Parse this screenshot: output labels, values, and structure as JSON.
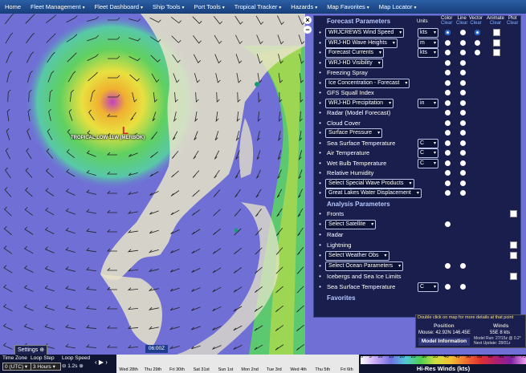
{
  "nav": [
    "Home",
    "Fleet Management",
    "Fleet Dashboard",
    "Ship Tools",
    "Port Tools",
    "Tropical Tracker",
    "Hazards",
    "Map Favorites",
    "Map Locator"
  ],
  "map": {
    "storm_label": "TROPICAL LOW 11W (MERBOK)",
    "storm_marker": "L"
  },
  "panel": {
    "title": "Forecast Parameters",
    "col_units": "Units",
    "col_color": "Color",
    "col_line": "Line",
    "col_vector": "Vector",
    "col_animate": "Animate",
    "col_plot": "Plot",
    "clear": "Clear",
    "forecast_rows": [
      {
        "label": "WRJCREWS Wind Speed",
        "select": true,
        "unit": "kts",
        "icon": "wind-icon"
      },
      {
        "label": "WRJ-HD Wave Heights",
        "select": true,
        "unit": "m",
        "icon": "wave-icon"
      },
      {
        "label": "Forecast Currents",
        "select": true,
        "unit": "kts",
        "icon": "current-icon"
      },
      {
        "label": "WRJ-HD Visibility",
        "select": true,
        "unit": "",
        "icon": "visibility-icon"
      },
      {
        "label": "Freezing Spray",
        "select": false,
        "unit": "",
        "icon": "spray-icon"
      },
      {
        "label": "Ice Concentration - Forecast",
        "select": true,
        "unit": "",
        "icon": "ice-icon"
      },
      {
        "label": "GFS Squall Index",
        "select": false,
        "unit": "",
        "icon": "squall-icon"
      },
      {
        "label": "WRJ-HD Precipitation",
        "select": true,
        "unit": "in",
        "icon": "drop-icon"
      },
      {
        "label": "Radar (Model Forecast)",
        "select": false,
        "unit": "",
        "icon": "radar-icon"
      },
      {
        "label": "Cloud Cover",
        "select": false,
        "unit": "",
        "icon": "cloud-icon"
      },
      {
        "label": "Surface Pressure",
        "select": true,
        "unit": "",
        "icon": "pressure-icon"
      },
      {
        "label": "Sea Surface Temperature",
        "select": false,
        "unit": "C",
        "icon": "thermometer-icon"
      },
      {
        "label": "Air Temperature",
        "select": false,
        "unit": "C",
        "icon": "thermometer-icon"
      },
      {
        "label": "Wet Bulb Temperature",
        "select": false,
        "unit": "C",
        "icon": "thermometer-icon"
      },
      {
        "label": "Relative Humidity",
        "select": false,
        "unit": "",
        "icon": "humidity-icon"
      },
      {
        "label": "Select Special Wave Products",
        "select": true,
        "unit": "",
        "icon": "wave-product-icon"
      },
      {
        "label": "Great Lakes Water Displacement",
        "select": true,
        "unit": "",
        "icon": "lake-icon"
      }
    ],
    "analysis_title": "Analysis Parameters",
    "analysis_rows": [
      {
        "label": "Fronts",
        "select": false,
        "icon": "fronts-icon"
      },
      {
        "label": "Select Satellite",
        "select": true,
        "icon": "satellite-icon"
      },
      {
        "label": "Radar",
        "select": false,
        "icon": "radar-icon"
      },
      {
        "label": "Lightning",
        "select": false,
        "icon": "lightning-icon"
      },
      {
        "label": "Select Weather Obs",
        "select": true,
        "icon": "obs-icon"
      },
      {
        "label": "Select Ocean Parameters",
        "select": true,
        "icon": "ocean-icon"
      },
      {
        "label": "Icebergs and Sea Ice Limits",
        "select": false,
        "icon": "iceberg-icon"
      },
      {
        "label": "Sea Surface Temperature",
        "select": false,
        "icon": "thermometer-icon",
        "unit": "C"
      }
    ],
    "favorites_title": "Favorites"
  },
  "info": {
    "note": "Double click on map for more details at that point",
    "position_hdr": "Position",
    "winds_hdr": "Winds",
    "position": "Mouse: 42.92N 146.45E",
    "winds": "55E 8 kts",
    "model_info": "Model Information",
    "model_run": "Model Run: 27/15z @ 0.2°",
    "next_update": "Next Update: 28/01z"
  },
  "bottom": {
    "settings": "Settings",
    "time_zone_lbl": "Time Zone",
    "time_zone": "0 (UTC)",
    "loop_step_lbl": "Loop Step",
    "loop_step": "3 Hours",
    "loop_speed_lbl": "Loop Speed",
    "loop_speed": "1.2s",
    "current_time": "06:00Z",
    "days": [
      "Wed 28th",
      "Thu 29th",
      "Fri 30th",
      "Sat 31st",
      "Sun 1st",
      "Mon 2nd",
      "Tue 3rd",
      "Wed 4th",
      "Thu 5th",
      "Fri 6th"
    ]
  },
  "legend": {
    "title": "Hi-Res Winds (kts)",
    "ticks": [
      "0",
      "5",
      "10",
      "15",
      "20",
      "25",
      "30",
      "35",
      "40",
      "45",
      "50",
      "55",
      "60",
      "65",
      "70",
      "75"
    ]
  }
}
